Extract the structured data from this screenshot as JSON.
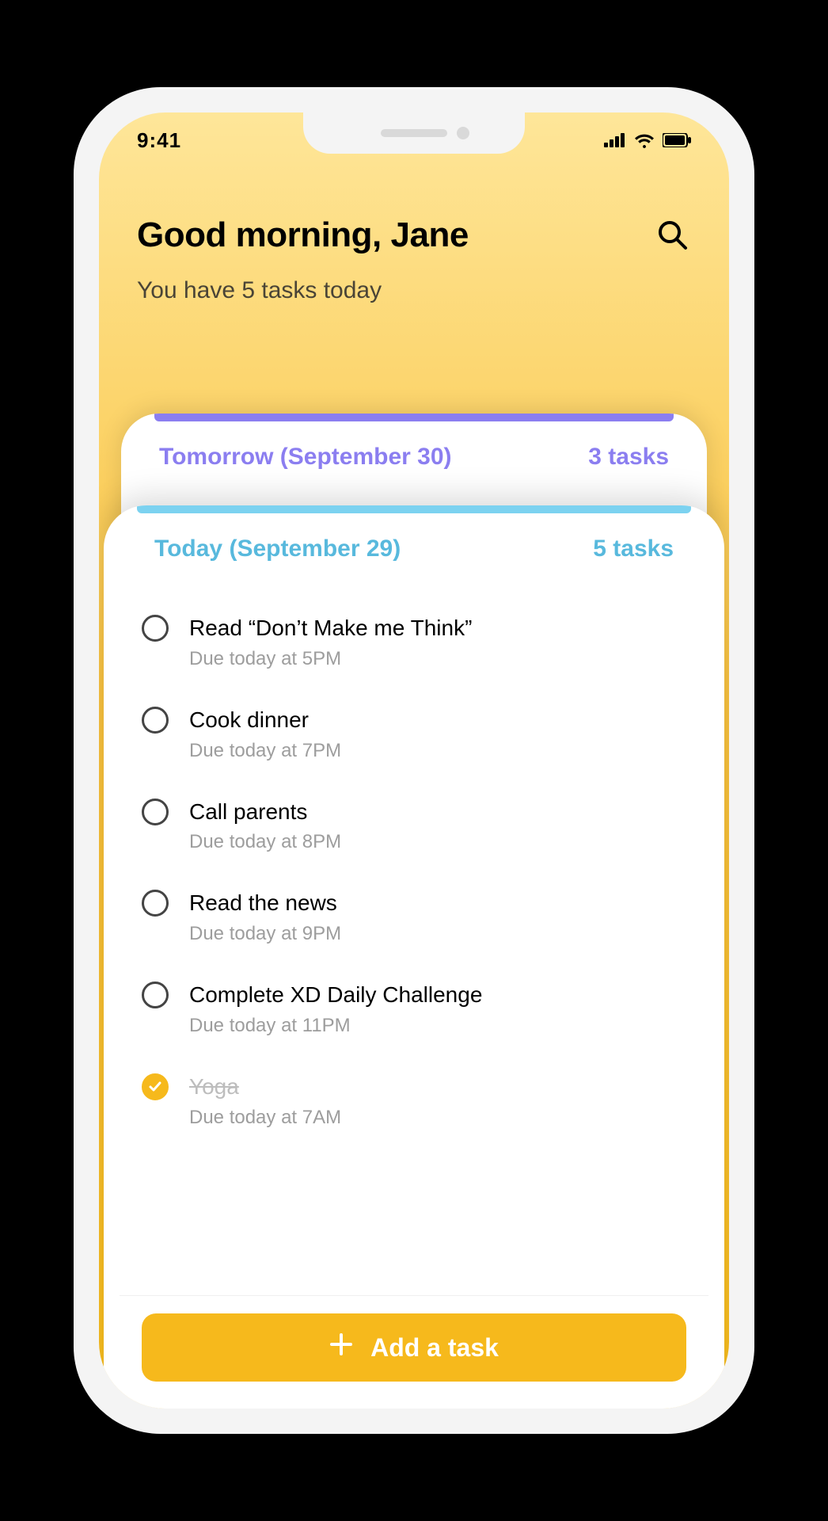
{
  "status_bar": {
    "time": "9:41"
  },
  "header": {
    "greeting": "Good morning, Jane",
    "subtitle": "You have 5 tasks today"
  },
  "colors": {
    "tomorrow_accent": "#8b7ef0",
    "today_accent": "#58b9dd",
    "primary_button": "#f6b91c"
  },
  "sections": {
    "tomorrow": {
      "label": "Tomorrow (September 30)",
      "count_label": "3 tasks"
    },
    "today": {
      "label": "Today (September 29)",
      "count_label": "5  tasks"
    }
  },
  "tasks": [
    {
      "title": "Read “Don’t Make me Think”",
      "due": "Due today at 5PM",
      "done": false
    },
    {
      "title": "Cook dinner",
      "due": "Due today at 7PM",
      "done": false
    },
    {
      "title": "Call parents",
      "due": "Due today at 8PM",
      "done": false
    },
    {
      "title": "Read the news",
      "due": "Due today at 9PM",
      "done": false
    },
    {
      "title": "Complete XD Daily Challenge",
      "due": "Due today at 11PM",
      "done": false
    },
    {
      "title": "Yoga",
      "due": "Due today at 7AM",
      "done": true
    }
  ],
  "add_button": {
    "label": "Add a task"
  }
}
